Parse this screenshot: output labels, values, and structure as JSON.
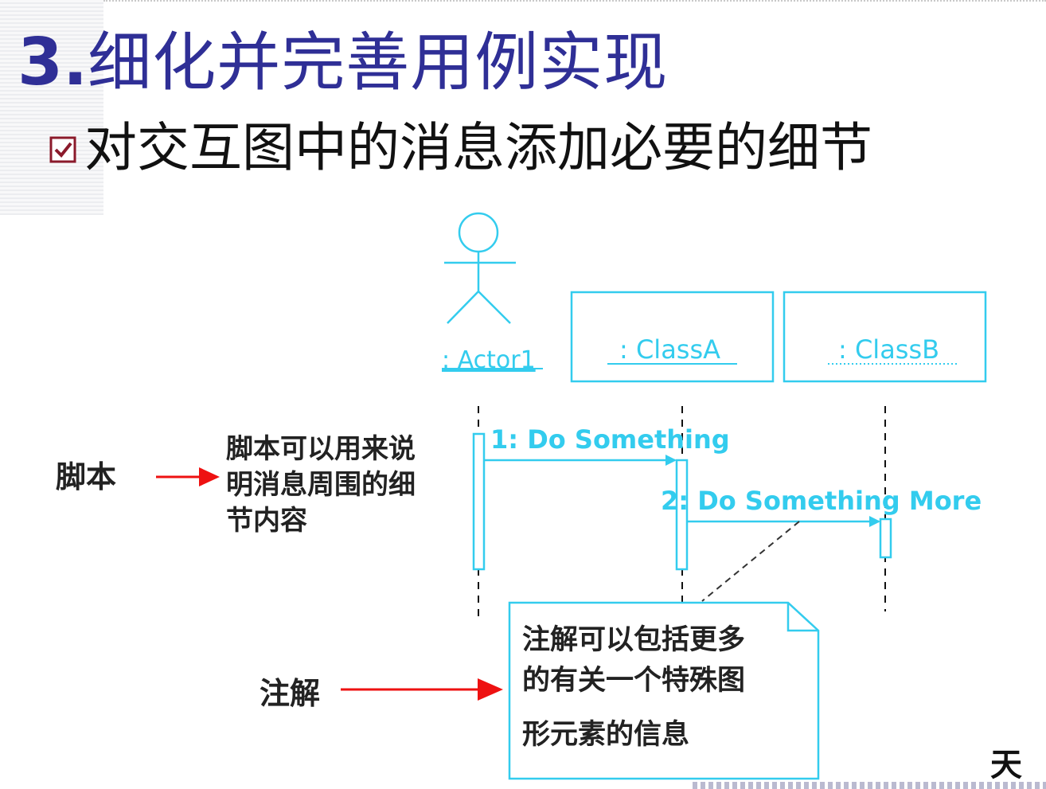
{
  "slide": {
    "title_number": "3.",
    "title_text": "细化并完善用例实现",
    "bullet_text": "对交互图中的消息添加必要的细节",
    "colors": {
      "title": "#2f2f96",
      "diagram_line": "#33ccee",
      "arrow": "#ee1111",
      "checkbox": "#8b1a2b"
    }
  },
  "diagram": {
    "actor_label": ": Actor1",
    "lifelines": [
      {
        "label": ": ClassA"
      },
      {
        "label": ": ClassB"
      }
    ],
    "messages": [
      {
        "label": "1: Do Something"
      },
      {
        "label": "2: Do Something More"
      }
    ],
    "script_label": "脚本",
    "script_text_lines": [
      "脚本可以用来说",
      "明消息周围的细",
      "节内容"
    ],
    "note_label": "注解",
    "note_text_lines": [
      "注解可以包括更多",
      "的有关一个特殊图",
      "形元素的信息"
    ]
  },
  "footer": {
    "brand_fragment": "天"
  }
}
